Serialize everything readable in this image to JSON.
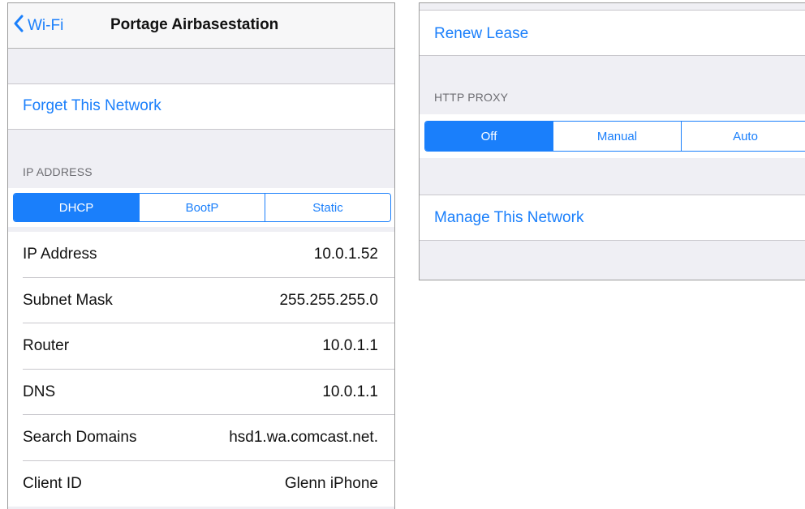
{
  "left": {
    "nav": {
      "back_label": "Wi-Fi",
      "title": "Portage Airbasestation"
    },
    "forget_label": "Forget This Network",
    "ip_section_header": "IP ADDRESS",
    "ip_modes": [
      "DHCP",
      "BootP",
      "Static"
    ],
    "ip_selected": "DHCP",
    "rows": [
      {
        "label": "IP Address",
        "value": "10.0.1.52"
      },
      {
        "label": "Subnet Mask",
        "value": "255.255.255.0"
      },
      {
        "label": "Router",
        "value": "10.0.1.1"
      },
      {
        "label": "DNS",
        "value": "10.0.1.1"
      },
      {
        "label": "Search Domains",
        "value": "hsd1.wa.comcast.net."
      },
      {
        "label": "Client ID",
        "value": "Glenn iPhone"
      }
    ]
  },
  "right": {
    "renew_label": "Renew Lease",
    "proxy_section_header": "HTTP PROXY",
    "proxy_modes": [
      "Off",
      "Manual",
      "Auto"
    ],
    "proxy_selected": "Off",
    "manage_label": "Manage This Network"
  },
  "colors": {
    "accent": "#1a7ffb",
    "group_bg": "#efeff4",
    "separator": "#c8c7cc"
  },
  "icons": {
    "back": "chevron-left-icon"
  }
}
